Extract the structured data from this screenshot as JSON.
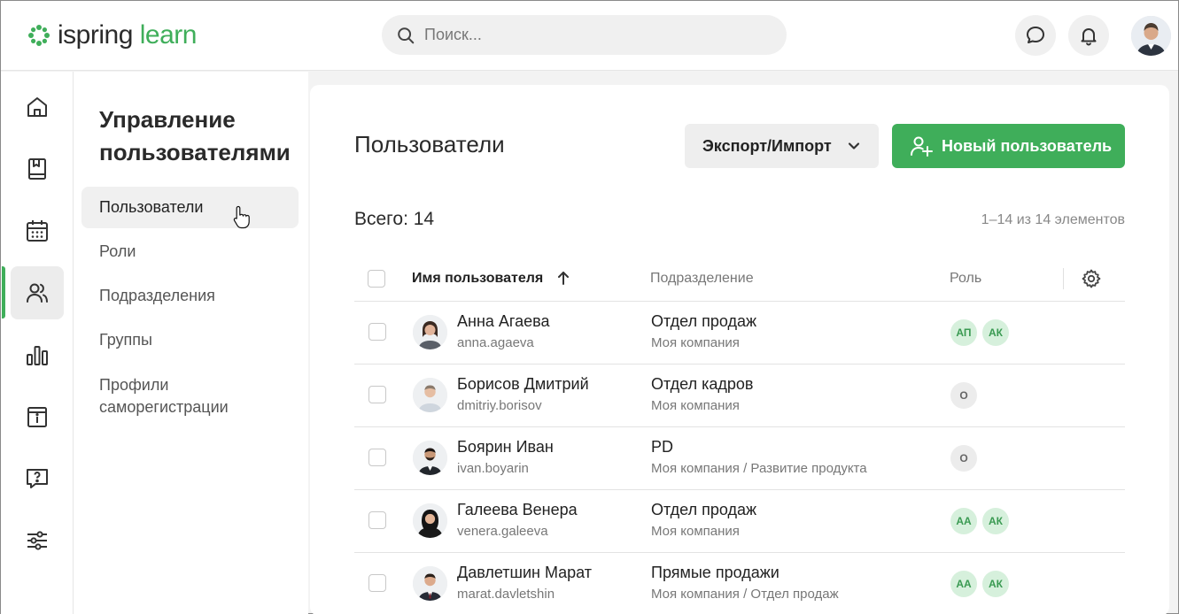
{
  "header": {
    "logo_part1": "ispring",
    "logo_part2": "learn",
    "search_placeholder": "Поиск..."
  },
  "rail": {
    "items": [
      "home-icon",
      "book-icon",
      "calendar-icon",
      "users-icon",
      "chart-icon",
      "info-board-icon",
      "help-icon",
      "settings-sliders-icon"
    ],
    "active": "users-icon"
  },
  "subnav": {
    "title": "Управление пользователями",
    "items": [
      {
        "label": "Пользователи"
      },
      {
        "label": "Роли"
      },
      {
        "label": "Подразделения"
      },
      {
        "label": "Группы"
      },
      {
        "label": "Профили саморегистрации"
      }
    ]
  },
  "main": {
    "title": "Пользователи",
    "export_label": "Экспорт/Импорт",
    "new_user_label": "Новый пользователь",
    "total": "Всего: 14",
    "range": "1–14 из 14 элементов",
    "columns": {
      "name": "Имя пользователя",
      "department": "Подразделение",
      "role": "Роль"
    },
    "rows": [
      {
        "name": "Анна Агаева",
        "login": "anna.agaeva",
        "dept": "Отдел продаж",
        "path": "Моя компания",
        "roles": [
          "АП",
          "АК"
        ],
        "role_style": "green"
      },
      {
        "name": "Борисов Дмитрий",
        "login": "dmitriy.borisov",
        "dept": "Отдел кадров",
        "path": "Моя компания",
        "roles": [
          "О"
        ],
        "role_style": "gray"
      },
      {
        "name": "Боярин Иван",
        "login": "ivan.boyarin",
        "dept": "PD",
        "path": "Моя компания / Развитие продукта",
        "roles": [
          "О"
        ],
        "role_style": "gray"
      },
      {
        "name": "Галеева Венера",
        "login": "venera.galeeva",
        "dept": "Отдел продаж",
        "path": "Моя компания",
        "roles": [
          "АА",
          "АК"
        ],
        "role_style": "green"
      },
      {
        "name": "Давлетшин Марат",
        "login": "marat.davletshin",
        "dept": "Прямые продажи",
        "path": "Моя компания / Отдел продаж",
        "roles": [
          "АА",
          "АК"
        ],
        "role_style": "green"
      }
    ]
  },
  "colors": {
    "brand_green": "#3fae5a",
    "badge_green_bg": "#d6f0dc",
    "badge_gray_bg": "#ececec"
  }
}
